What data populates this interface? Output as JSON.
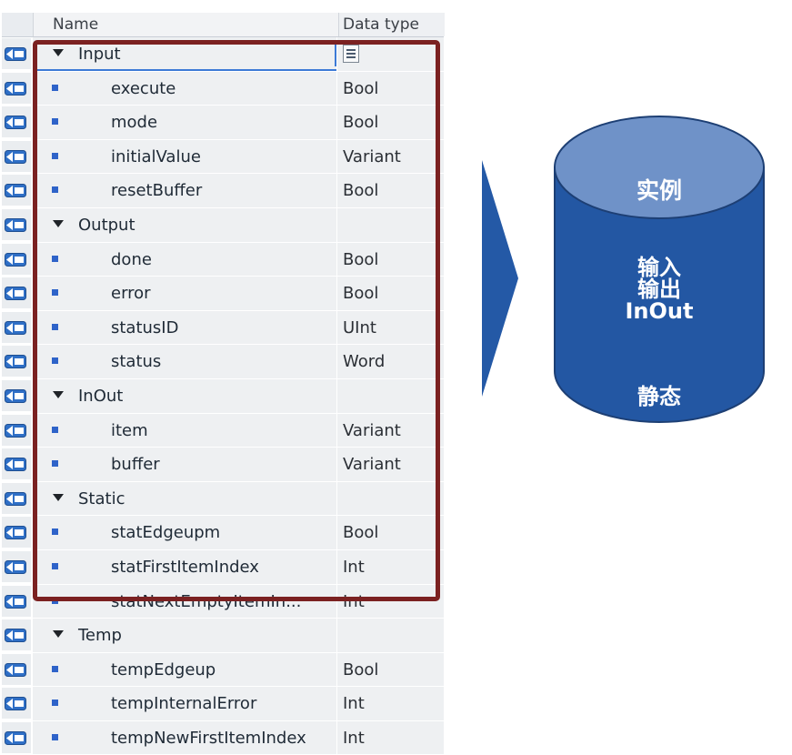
{
  "table": {
    "headers": {
      "name": "Name",
      "data_type": "Data type"
    },
    "rows": [
      {
        "kind": "group",
        "name": "Input",
        "type": ""
      },
      {
        "kind": "leaf",
        "name": "execute",
        "type": "Bool"
      },
      {
        "kind": "leaf",
        "name": "mode",
        "type": "Bool"
      },
      {
        "kind": "leaf",
        "name": "initialValue",
        "type": "Variant"
      },
      {
        "kind": "leaf",
        "name": "resetBuffer",
        "type": "Bool"
      },
      {
        "kind": "group",
        "name": "Output",
        "type": ""
      },
      {
        "kind": "leaf",
        "name": "done",
        "type": "Bool"
      },
      {
        "kind": "leaf",
        "name": "error",
        "type": "Bool"
      },
      {
        "kind": "leaf",
        "name": "statusID",
        "type": "UInt"
      },
      {
        "kind": "leaf",
        "name": "status",
        "type": "Word"
      },
      {
        "kind": "group",
        "name": "InOut",
        "type": ""
      },
      {
        "kind": "leaf",
        "name": "item",
        "type": "Variant"
      },
      {
        "kind": "leaf",
        "name": "buffer",
        "type": "Variant"
      },
      {
        "kind": "group",
        "name": "Static",
        "type": ""
      },
      {
        "kind": "leaf",
        "name": "statEdgeupm",
        "type": "Bool"
      },
      {
        "kind": "leaf",
        "name": "statFirstItemIndex",
        "type": "Int"
      },
      {
        "kind": "leaf",
        "name": "statNextEmptyItemIn...",
        "type": "Int"
      },
      {
        "kind": "group",
        "name": "Temp",
        "type": ""
      },
      {
        "kind": "leaf",
        "name": "tempEdgeup",
        "type": "Bool"
      },
      {
        "kind": "leaf",
        "name": "tempInternalError",
        "type": "Int"
      },
      {
        "kind": "leaf",
        "name": "tempNewFirstItemIndex",
        "type": "Int"
      }
    ]
  },
  "instance_db": {
    "title": "实例",
    "line1": "输入",
    "line2": "输出",
    "line3": "InOut",
    "line4": "静态"
  },
  "colors": {
    "highlight_border": "#7b2121",
    "cylinder_fill": "#2357a3",
    "cylinder_top": "#6f92c8",
    "arrow": "#2459a6",
    "bullet": "#2e63c9"
  },
  "icons": {
    "row_icon": "interface-param-icon",
    "group_toggle": "expand-triangle-icon",
    "leaf_marker": "bullet-square-icon",
    "type_picker": "list-picker-icon"
  }
}
